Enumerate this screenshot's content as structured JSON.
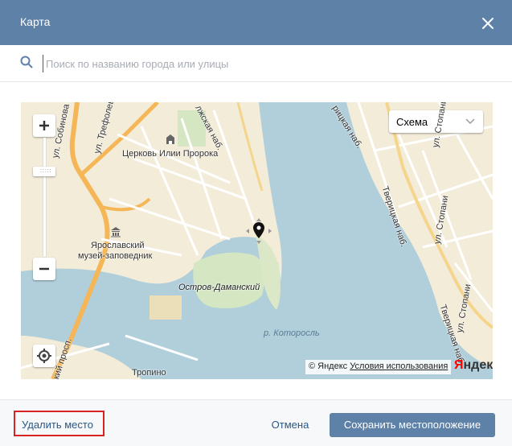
{
  "window": {
    "title": "Карта"
  },
  "search": {
    "placeholder": "Поиск по названию города или улицы"
  },
  "map": {
    "layer_selector": "Схема",
    "labels": {
      "church": "Церковь Илии Пророка",
      "museum_line1": "Ярославский",
      "museum_line2": "музей-заповедник",
      "island": "Остров-Даманский",
      "river": "р. Которосль",
      "district": "Тропино",
      "street_trefoleva": "ул. Трефолева",
      "street_sobinova": "ул. Собинова",
      "embankment_left": "лжская наб.",
      "embankment_right": "рицкая наб.",
      "street_stopani_1": "ул. Стопани",
      "street_stopani_2": "ул. Стопани",
      "street_stopani_3": "ул. Стопани",
      "tveritskaya_1": "Тверицкая наб.",
      "tveritskaya_2": "Тверицкая наб.",
      "prospekt": "кий просп."
    },
    "copyright": "© Яндекс",
    "terms_link": "Условия использования",
    "logo_prefix": "Я",
    "logo_rest": "ндекс"
  },
  "footer": {
    "delete": "Удалить место",
    "cancel": "Отмена",
    "save": "Сохранить местоположение"
  },
  "colors": {
    "header": "#5e81a8",
    "link": "#2a5885",
    "water": "#b1cedb",
    "land": "#f3ecd9",
    "road": "#f5b657",
    "delete_outline": "#d92323"
  }
}
